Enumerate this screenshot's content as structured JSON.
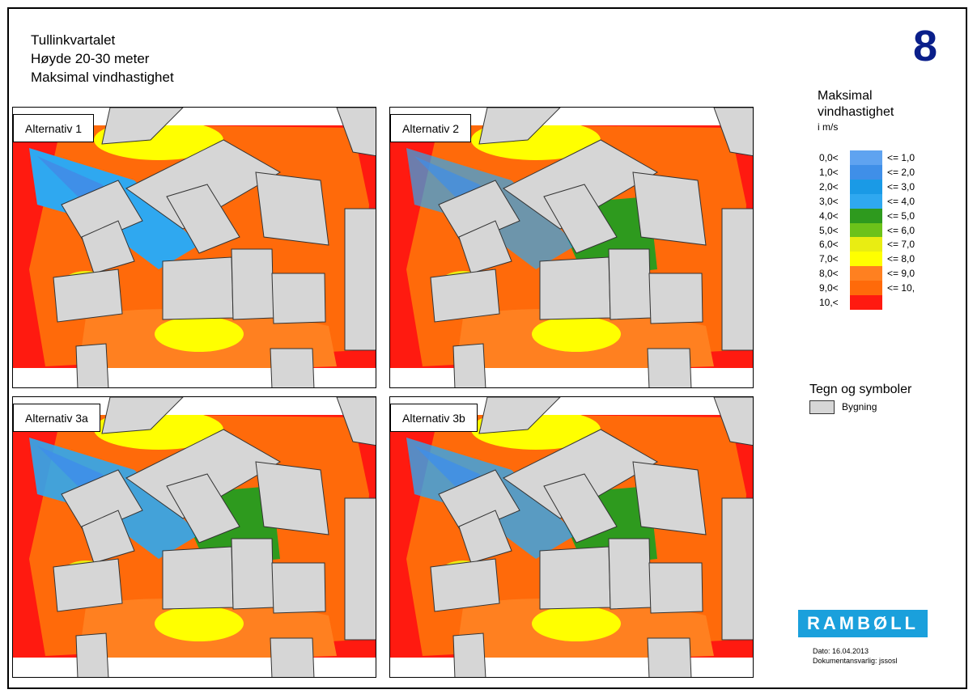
{
  "title_lines": [
    "Tullinkvartalet",
    "Høyde 20-30 meter",
    "Maksimal vindhastighet"
  ],
  "sheet_number": "8",
  "panels": [
    {
      "label": "Alternativ 1"
    },
    {
      "label": "Alternativ 2"
    },
    {
      "label": "Alternativ 3a"
    },
    {
      "label": "Alternativ 3b"
    }
  ],
  "legend": {
    "title_line1": "Maksimal",
    "title_line2": "vindhastighet",
    "unit": "i m/s",
    "rows": [
      {
        "lo": "0,0<",
        "hi": "<= 1,0",
        "color": "#5fa3f0"
      },
      {
        "lo": "1,0<",
        "hi": "<= 2,0",
        "color": "#3f8fe8"
      },
      {
        "lo": "2,0<",
        "hi": "<= 3,0",
        "color": "#1a9ae6"
      },
      {
        "lo": "3,0<",
        "hi": "<= 4,0",
        "color": "#2fa8f0"
      },
      {
        "lo": "4,0<",
        "hi": "<= 5,0",
        "color": "#2e9a1e"
      },
      {
        "lo": "5,0<",
        "hi": "<= 6,0",
        "color": "#6cc21a"
      },
      {
        "lo": "6,0<",
        "hi": "<= 7,0",
        "color": "#e9ed12"
      },
      {
        "lo": "7,0<",
        "hi": "<= 8,0",
        "color": "#ffff00"
      },
      {
        "lo": "8,0<",
        "hi": "<= 9,0",
        "color": "#ff8020"
      },
      {
        "lo": "9,0<",
        "hi": "<= 10,",
        "color": "#ff6a0a"
      },
      {
        "lo": "10,<",
        "hi": "",
        "color": "#ff1a10"
      }
    ]
  },
  "symbols": {
    "title": "Tegn og symboler",
    "building": "Bygning"
  },
  "logo": "RAMBØLL",
  "date": "Dato: 16.04.2013",
  "responsible": "Dokumentansvarlig: jssosl"
}
